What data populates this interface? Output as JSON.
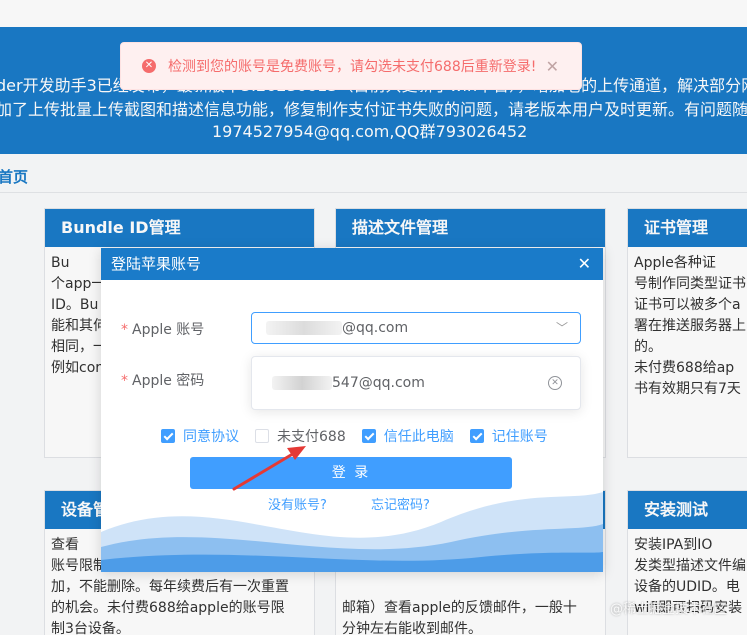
{
  "banner": {
    "line1": "der开发助手3已经发布，最新版本3.20230613（目前只更新了win平台），增加老的上传通道，解决部分网络",
    "line2": "加了上传批量上传截图和描述信息功能，修复制作支付证书失败的问题，请老版本用户及时更新。有问题随时",
    "line3": "1974527954@qq.com,QQ群793026452"
  },
  "breadcrumb": "首页",
  "cards": {
    "bundle": {
      "title": "Bundle ID管理",
      "body": "        Bu\n个app一\nID。Bu\n能和其何\n相同，一\n例如cor"
    },
    "profile": {
      "title": "描述文件管理",
      "body": ""
    },
    "cert": {
      "title": "证书管理",
      "body": "        Apple各种证\n号制作同类型证书\n证书可以被多个a\n署在推送服务器上\n的。\n    未付费688给ap\n书有效期只有7天"
    },
    "device": {
      "title": "设备管",
      "body": "        查看\n账号限制\n加，不能删除。每年续费后有一次重置\n的机会。未付费688给apple的账号限\n制3台设备。"
    },
    "mid": {
      "title": "",
      "body": "\n\n\n邮箱）查看apple的反馈邮件，一般十\n分钟左右能收到邮件。\n    Ipa必须使用发布证书编译，未付费"
    },
    "install": {
      "title": "安装测试",
      "body": "        安装IPA到IO\n发类型描述文件编\n设备的UDID。电\nwifi即可扫码安装"
    }
  },
  "toast": {
    "message": "检测到您的账号是免费账号，请勾选未支付688后重新登录!",
    "color": "#f56c6c"
  },
  "dialog": {
    "title": "登陆苹果账号",
    "account_label": "Apple 账号",
    "account_value_suffix": "@qq.com",
    "password_label": "Apple 密码",
    "dropdown_option_suffix": "547@qq.com",
    "checkboxes": [
      {
        "label": "同意协议",
        "checked": true
      },
      {
        "label": "未支付688",
        "checked": false
      },
      {
        "label": "信任此电脑",
        "checked": true
      },
      {
        "label": "记住账号",
        "checked": true
      }
    ],
    "login_button": "登 录",
    "no_account_link": "没有账号?",
    "forgot_link": "忘记密码?"
  },
  "watermark": "@稀土掘金技术社区",
  "colors": {
    "primary": "#1a7bc9",
    "accent": "#409eff",
    "danger": "#f56c6c"
  }
}
